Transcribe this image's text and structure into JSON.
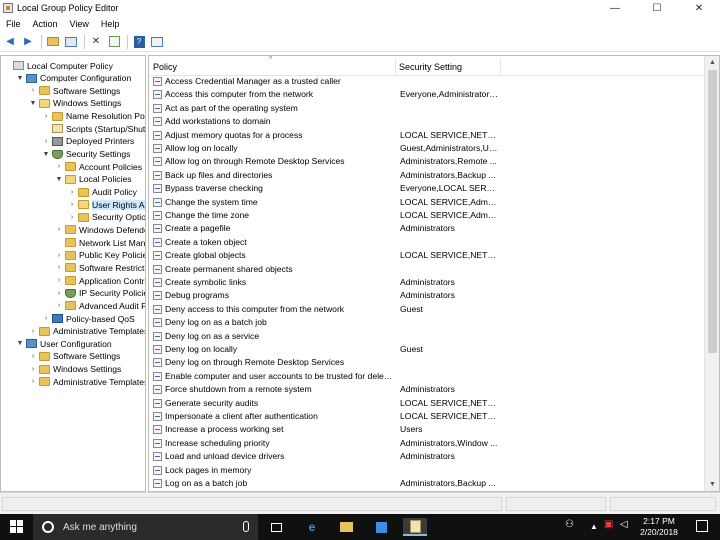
{
  "window": {
    "title": "Local Group Policy Editor",
    "controls": {
      "minimize": "—",
      "maximize": "☐",
      "close": "✕"
    }
  },
  "menu": [
    "File",
    "Action",
    "View",
    "Help"
  ],
  "toolbar": {
    "icons": [
      "back-arrow-icon",
      "forward-arrow-icon",
      "up-folder-icon",
      "show-hide-tree-icon",
      "delete-icon",
      "export-list-icon",
      "help-icon",
      "properties-icon"
    ]
  },
  "tree": [
    {
      "label": "Local Computer Policy",
      "icon": "policy",
      "exp": ""
    },
    {
      "label": "Computer Configuration",
      "icon": "computer",
      "exp": "▼"
    },
    {
      "label": "Software Settings",
      "icon": "folder",
      "exp": "›"
    },
    {
      "label": "Windows Settings",
      "icon": "folder-open",
      "exp": "▼"
    },
    {
      "label": "Name Resolution Policy",
      "icon": "folder",
      "exp": "›"
    },
    {
      "label": "Scripts (Startup/Shutdown)",
      "icon": "scroll",
      "exp": ""
    },
    {
      "label": "Deployed Printers",
      "icon": "printer",
      "exp": "›"
    },
    {
      "label": "Security Settings",
      "icon": "shield",
      "exp": "▼"
    },
    {
      "label": "Account Policies",
      "icon": "folder",
      "exp": "›"
    },
    {
      "label": "Local Policies",
      "icon": "folder-open",
      "exp": "▼"
    },
    {
      "label": "Audit Policy",
      "icon": "folder",
      "exp": "›"
    },
    {
      "label": "User Rights Assignment",
      "icon": "folder-open",
      "exp": "›",
      "selected": true
    },
    {
      "label": "Security Options",
      "icon": "folder",
      "exp": "›"
    },
    {
      "label": "Windows Defender Firewall",
      "icon": "folder",
      "exp": "›"
    },
    {
      "label": "Network List Manager Policies",
      "icon": "folder",
      "exp": ""
    },
    {
      "label": "Public Key Policies",
      "icon": "folder",
      "exp": "›"
    },
    {
      "label": "Software Restriction Policies",
      "icon": "folder",
      "exp": "›"
    },
    {
      "label": "Application Control Policies",
      "icon": "folder",
      "exp": "›"
    },
    {
      "label": "IP Security Policies",
      "icon": "shield",
      "exp": "›"
    },
    {
      "label": "Advanced Audit Policy",
      "icon": "folder",
      "exp": "›"
    },
    {
      "label": "Policy-based QoS",
      "icon": "chart",
      "exp": "›"
    },
    {
      "label": "Administrative Templates",
      "icon": "folder",
      "exp": "›"
    },
    {
      "label": "User Configuration",
      "icon": "computer",
      "exp": "▼"
    },
    {
      "label": "Software Settings",
      "icon": "folder",
      "exp": "›"
    },
    {
      "label": "Windows Settings",
      "icon": "folder",
      "exp": "›"
    },
    {
      "label": "Administrative Templates",
      "icon": "folder",
      "exp": "›"
    }
  ],
  "list": {
    "headers": {
      "policy": "Policy",
      "setting": "Security Setting"
    },
    "rows": [
      {
        "policy": "Access Credential Manager as a trusted caller",
        "setting": ""
      },
      {
        "policy": "Access this computer from the network",
        "setting": "Everyone,Administrators..."
      },
      {
        "policy": "Act as part of the operating system",
        "setting": ""
      },
      {
        "policy": "Add workstations to domain",
        "setting": ""
      },
      {
        "policy": "Adjust memory quotas for a process",
        "setting": "LOCAL SERVICE,NETWO..."
      },
      {
        "policy": "Allow log on locally",
        "setting": "Guest,Administrators,Us..."
      },
      {
        "policy": "Allow log on through Remote Desktop Services",
        "setting": "Administrators,Remote ..."
      },
      {
        "policy": "Back up files and directories",
        "setting": "Administrators,Backup ..."
      },
      {
        "policy": "Bypass traverse checking",
        "setting": "Everyone,LOCAL SERVIC..."
      },
      {
        "policy": "Change the system time",
        "setting": "LOCAL SERVICE,Admini..."
      },
      {
        "policy": "Change the time zone",
        "setting": "LOCAL SERVICE,Admini..."
      },
      {
        "policy": "Create a pagefile",
        "setting": "Administrators"
      },
      {
        "policy": "Create a token object",
        "setting": ""
      },
      {
        "policy": "Create global objects",
        "setting": "LOCAL SERVICE,NETWO..."
      },
      {
        "policy": "Create permanent shared objects",
        "setting": ""
      },
      {
        "policy": "Create symbolic links",
        "setting": "Administrators"
      },
      {
        "policy": "Debug programs",
        "setting": "Administrators"
      },
      {
        "policy": "Deny access to this computer from the network",
        "setting": "Guest"
      },
      {
        "policy": "Deny log on as a batch job",
        "setting": ""
      },
      {
        "policy": "Deny log on as a service",
        "setting": ""
      },
      {
        "policy": "Deny log on locally",
        "setting": "Guest"
      },
      {
        "policy": "Deny log on through Remote Desktop Services",
        "setting": ""
      },
      {
        "policy": "Enable computer and user accounts to be trusted for delega...",
        "setting": ""
      },
      {
        "policy": "Force shutdown from a remote system",
        "setting": "Administrators"
      },
      {
        "policy": "Generate security audits",
        "setting": "LOCAL SERVICE,NETWO..."
      },
      {
        "policy": "Impersonate a client after authentication",
        "setting": "LOCAL SERVICE,NETWO..."
      },
      {
        "policy": "Increase a process working set",
        "setting": "Users"
      },
      {
        "policy": "Increase scheduling priority",
        "setting": "Administrators,Window ..."
      },
      {
        "policy": "Load and unload device drivers",
        "setting": "Administrators"
      },
      {
        "policy": "Lock pages in memory",
        "setting": ""
      },
      {
        "policy": "Log on as a batch job",
        "setting": "Administrators,Backup ..."
      }
    ]
  },
  "taskbar": {
    "search_placeholder": "Ask me anything",
    "time": "2:17 PM",
    "date": "2/20/2018"
  }
}
